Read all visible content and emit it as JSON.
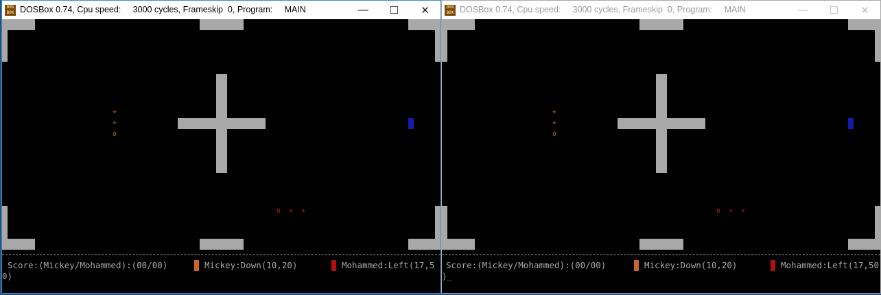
{
  "window_left": {
    "title": "DOSBox 0.74, Cpu speed:     3000 cycles, Frameskip  0, Program:     MAIN",
    "active": true
  },
  "window_right": {
    "title": "DOSBox 0.74, Cpu speed:     3000 cycles, Frameskip  0, Program:     MAIN",
    "active": false
  },
  "app_icon_text": "DOS BOX",
  "controls": {
    "minimize": "—",
    "maximize": "☐",
    "close": "✕"
  },
  "game": {
    "sprite_orange_vertical": [
      "+",
      "+",
      "o"
    ],
    "sprite_red_horizontal": "o + +",
    "status_line_left": "Score:(Mickey/Mohammed):(00/00)",
    "status_player1": "Mickey:Down(10,20)",
    "status_player2_left": "Mohammed:Left(17,5",
    "status_player2_right": "Mohammed:Left(17,50",
    "status_cont_left": "0)",
    "status_cont_right": ")_",
    "colors": {
      "player1": "#c8662a",
      "player2": "#b01010",
      "blue_block": "#1a1aa8",
      "walls": "#a8a8a8"
    }
  }
}
